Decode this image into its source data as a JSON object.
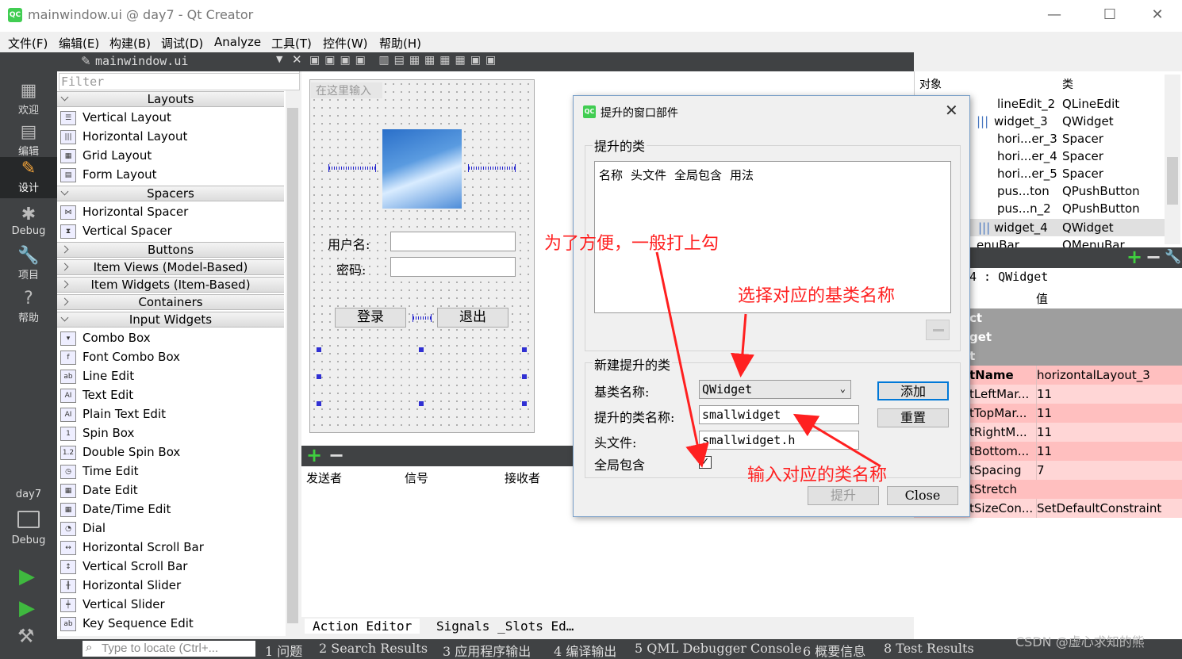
{
  "window": {
    "title": "mainwindow.ui @ day7 - Qt Creator",
    "logo": "QC"
  },
  "menubar": [
    "文件(F)",
    "编辑(E)",
    "构建(B)",
    "调试(D)",
    "Analyze",
    "工具(T)",
    "控件(W)",
    "帮助(H)"
  ],
  "modes": [
    {
      "label": "欢迎",
      "icon": "grid-icon"
    },
    {
      "label": "编辑",
      "icon": "doc-icon"
    },
    {
      "label": "设计",
      "icon": "pencil-icon"
    },
    {
      "label": "Debug",
      "icon": "bug-icon"
    },
    {
      "label": "项目",
      "icon": "wrench-icon"
    },
    {
      "label": "帮助",
      "icon": "question-icon"
    }
  ],
  "kit": {
    "project": "day7",
    "mode": "Debug"
  },
  "document": {
    "name": "mainwindow.ui"
  },
  "widgetbox": {
    "filter": "Filter",
    "categories": {
      "layouts": "Layouts",
      "spacers": "Spacers",
      "buttons": "Buttons",
      "item_views": "Item Views (Model-Based)",
      "item_widgets": "Item Widgets (Item-Based)",
      "containers": "Containers",
      "input_widgets": "Input Widgets"
    },
    "layouts": [
      "Vertical Layout",
      "Horizontal Layout",
      "Grid Layout",
      "Form Layout"
    ],
    "spacers": [
      "Horizontal Spacer",
      "Vertical Spacer"
    ],
    "inputs": [
      "Combo Box",
      "Font Combo Box",
      "Line Edit",
      "Text Edit",
      "Plain Text Edit",
      "Spin Box",
      "Double Spin Box",
      "Time Edit",
      "Date Edit",
      "Date/Time Edit",
      "Dial",
      "Horizontal Scroll Bar",
      "Vertical Scroll Bar",
      "Horizontal Slider",
      "Vertical Slider",
      "Key Sequence Edit"
    ]
  },
  "form": {
    "menu_placeholder": "在这里输入",
    "user_label": "用户名:",
    "pwd_label": "密码:",
    "login": "登录",
    "exit": "退出"
  },
  "signals": {
    "sender": "发送者",
    "signal": "信号",
    "receiver": "接收者"
  },
  "bottom_tabs": [
    "Action Editor",
    "Signals _Slots Ed…"
  ],
  "locator": {
    "placeholder": "Type to locate (Ctrl+...",
    "tabs": [
      "1 问题",
      "2 Search Results",
      "3 应用程序输出",
      "4 编译输出",
      "5 QML Debugger Console",
      "6 概要信息",
      "8 Test Results"
    ]
  },
  "objects": {
    "header_obj": "对象",
    "header_class": "类",
    "rows": [
      {
        "name": "lineEdit_2",
        "cls": "QLineEdit",
        "icon": false
      },
      {
        "name": "widget_3",
        "cls": "QWidget",
        "icon": true
      },
      {
        "name": "hori...er_3",
        "cls": "Spacer",
        "icon": false
      },
      {
        "name": "hori...er_4",
        "cls": "Spacer",
        "icon": false
      },
      {
        "name": "hori...er_5",
        "cls": "Spacer",
        "icon": false
      },
      {
        "name": "pus...ton",
        "cls": "QPushButton",
        "icon": false
      },
      {
        "name": "pus...n_2",
        "cls": "QPushButton",
        "icon": false
      },
      {
        "name": "widget_4",
        "cls": "QWidget",
        "icon": true
      },
      {
        "name": "enuBar",
        "cls": "QMenuBar",
        "icon": false
      }
    ]
  },
  "properties": {
    "title": "4 : QWidget",
    "value_header": "值",
    "sections": [
      "ct",
      "get",
      "t"
    ],
    "rows": [
      {
        "name": "tName",
        "value": "horizontalLayout_3"
      },
      {
        "name": "tLeftMar...",
        "value": "11"
      },
      {
        "name": "tTopMar...",
        "value": "11"
      },
      {
        "name": "tRightM...",
        "value": "11"
      },
      {
        "name": "tBottom...",
        "value": "11"
      },
      {
        "name": "tSpacing",
        "value": "7"
      },
      {
        "name": "tStretch",
        "value": ""
      },
      {
        "name": "tSizeCon...",
        "value": "SetDefaultConstraint"
      }
    ]
  },
  "dialog": {
    "title": "提升的窗口部件",
    "group_promoted": "提升的类",
    "columns": [
      "名称",
      "头文件",
      "全局包含",
      "用法"
    ],
    "group_new": "新建提升的类",
    "base_label": "基类名称:",
    "base_value": "QWidget",
    "class_label": "提升的类名称:",
    "class_value": "smallwidget",
    "header_label": "头文件:",
    "header_value": "smallwidget.h",
    "global_label": "全局包含",
    "global_checked": true,
    "add": "添加",
    "reset": "重置",
    "promote": "提升",
    "close": "Close"
  },
  "annotations": {
    "a1": "为了方便，一般打上勾",
    "a2": "选择对应的基类名称",
    "a3": "输入对应的类名称"
  },
  "watermark": "CSDN @虚心求知的熊",
  "colors": {
    "dark_panel": "#404244",
    "highlight_row": "#ffbfbf",
    "annotation": "#ff2020",
    "qt_green": "#41cd52"
  }
}
